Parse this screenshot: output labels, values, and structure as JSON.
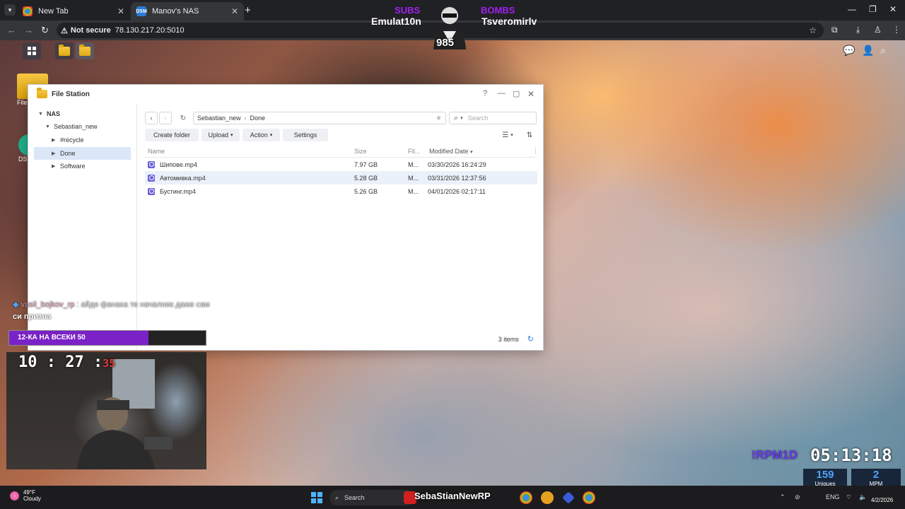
{
  "browser": {
    "tabs": [
      {
        "title": "New Tab"
      },
      {
        "title": "Manov's NAS"
      }
    ],
    "address": {
      "security_label": "Not secure",
      "url": "78.130.217.20:5010"
    }
  },
  "overlay": {
    "subs_label": "SUBS",
    "subs_name": "Emulat10n",
    "bombs_label": "BOMBS",
    "bombs_name": "Tsveromirlv",
    "count": "985",
    "chat_user": "vasil_bojkov_rp",
    "chat_message": ": айде фанака те началник даже сам",
    "chat_continuation": "си призна",
    "goal_label": "12-КА НА ВСЕКИ 50",
    "goal_fill_fraction": 0.71,
    "cam_clock_hm": "10 : 27 :",
    "cam_clock_s": "35",
    "rpm_label": "!RPM1D",
    "rpm_time": "05:13:18",
    "uniques_value": "159",
    "uniques_label": "Uniques",
    "mpm_value": "2",
    "mpm_label": "MPM",
    "brand": "SebaStianNewRP"
  },
  "desktop_icons": [
    {
      "label": "File"
    },
    {
      "label": "DS"
    }
  ],
  "file_station": {
    "title": "File Station",
    "tree": [
      {
        "label": "NAS"
      },
      {
        "label": "Sebastian_new"
      },
      {
        "label": "#recycle"
      },
      {
        "label": "Done"
      },
      {
        "label": "Software"
      }
    ],
    "path": [
      "Sebastian_new",
      "Done"
    ],
    "search_placeholder": "Search",
    "actions": {
      "create_folder": "Create folder",
      "upload": "Upload",
      "action": "Action",
      "settings": "Settings"
    },
    "columns": {
      "name": "Name",
      "size": "Size",
      "type": "Fil...",
      "modified": "Modified Date"
    },
    "files": [
      {
        "name": "Шипове.mp4",
        "size": "7.97 GB",
        "type": "M...",
        "modified": "03/30/2026 16:24:29"
      },
      {
        "name": "Автомивка.mp4",
        "size": "5.28 GB",
        "type": "M...",
        "modified": "03/31/2026 12:37:56"
      },
      {
        "name": "Бустинг.mp4",
        "size": "5.26 GB",
        "type": "M...",
        "modified": "04/01/2026 02:17:11"
      }
    ],
    "item_count": "3 items"
  },
  "taskbar": {
    "weather_temp": "49°F",
    "weather_desc": "Cloudy",
    "search_label": "Search",
    "language": "ENG",
    "date": "4/2/2026"
  },
  "colors": {
    "accent_purple": "#7a22c8",
    "dsm_blue": "#2a7bd6",
    "video_icon": "#6b5fd6"
  }
}
